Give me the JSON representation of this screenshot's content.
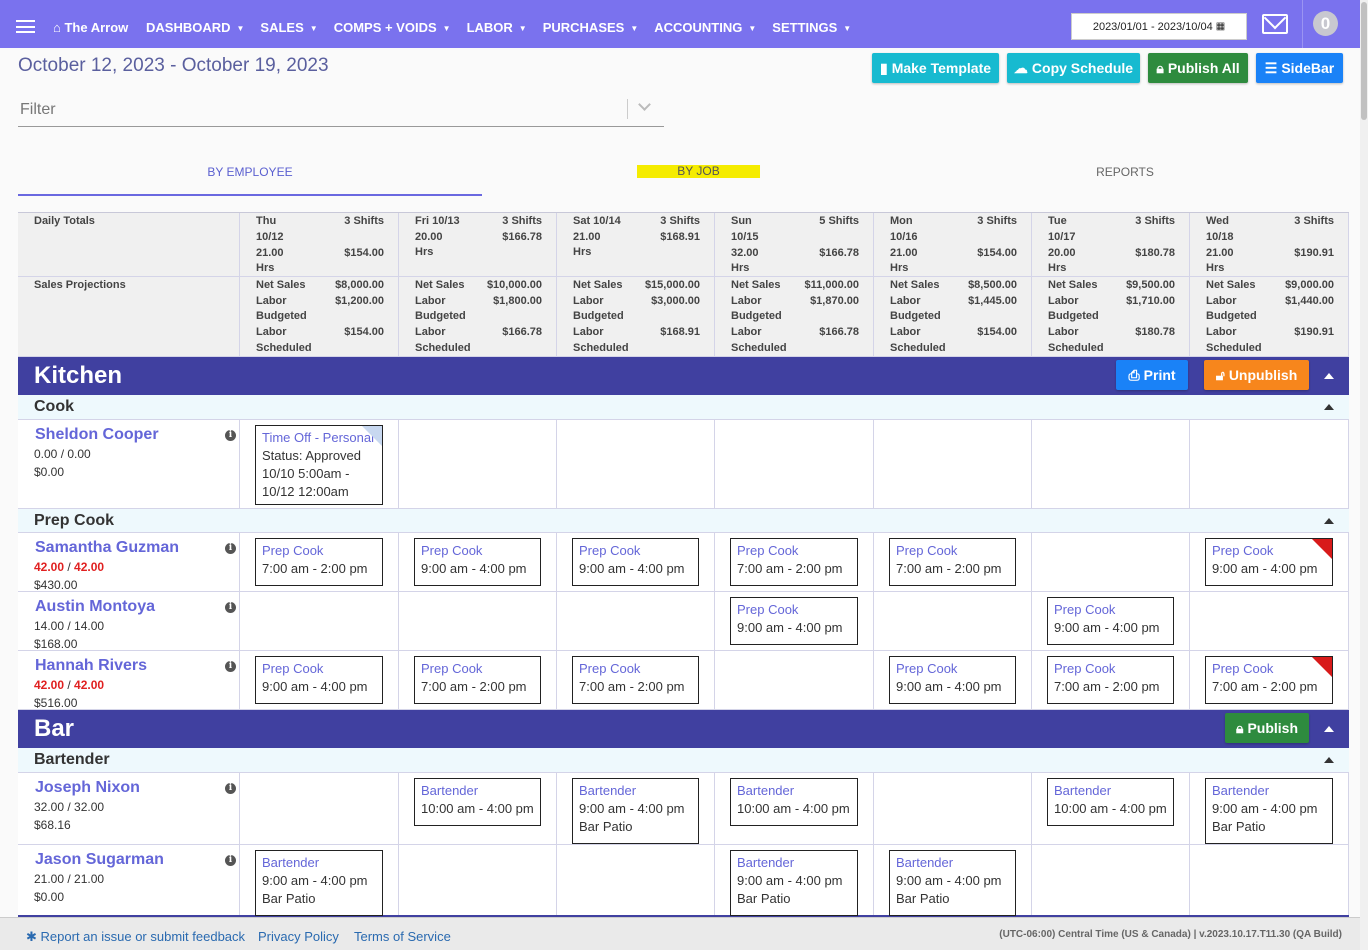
{
  "nav": {
    "brand": "The Arrow",
    "menu": [
      {
        "label": "DASHBOARD"
      },
      {
        "label": "SALES"
      },
      {
        "label": "COMPS + VOIDS"
      },
      {
        "label": "LABOR"
      },
      {
        "label": "PURCHASES"
      },
      {
        "label": "ACCOUNTING"
      },
      {
        "label": "SETTINGS"
      }
    ],
    "date_range": "2023/01/01 - 2023/10/04",
    "avatar": "0"
  },
  "header": {
    "week": "October 12, 2023 - October 19, 2023",
    "buttons": {
      "make_template": "Make Template",
      "copy_schedule": "Copy Schedule",
      "publish_all": "Publish All",
      "sidebar": "SideBar"
    },
    "filter_placeholder": "Filter"
  },
  "tabs": {
    "by_employee": "BY EMPLOYEE",
    "by_job": "BY JOB",
    "reports": "REPORTS"
  },
  "totals": {
    "label": "Daily Totals",
    "days": [
      {
        "day": "Thu",
        "date": "10/12",
        "shifts": "3 Shifts",
        "hrs": "21.00",
        "hrs_unit": "Hrs",
        "cost": "$154.00"
      },
      {
        "day": "Fri 10/13",
        "date": "",
        "shifts": "3 Shifts",
        "hrs": "20.00",
        "hrs_unit": "Hrs",
        "cost": "$166.78"
      },
      {
        "day": "Sat 10/14",
        "date": "",
        "shifts": "3 Shifts",
        "hrs": "21.00",
        "hrs_unit": "Hrs",
        "cost": "$168.91"
      },
      {
        "day": "Sun",
        "date": "10/15",
        "shifts": "5 Shifts",
        "hrs": "32.00",
        "hrs_unit": "Hrs",
        "cost": "$166.78"
      },
      {
        "day": "Mon",
        "date": "10/16",
        "shifts": "3 Shifts",
        "hrs": "21.00",
        "hrs_unit": "Hrs",
        "cost": "$154.00"
      },
      {
        "day": "Tue",
        "date": "10/17",
        "shifts": "3 Shifts",
        "hrs": "20.00",
        "hrs_unit": "Hrs",
        "cost": "$180.78"
      },
      {
        "day": "Wed",
        "date": "10/18",
        "shifts": "3 Shifts",
        "hrs": "21.00",
        "hrs_unit": "Hrs",
        "cost": "$190.91"
      }
    ]
  },
  "projections": {
    "label": "Sales Projections",
    "net_sales_label": "Net Sales",
    "labor_label": "Labor",
    "budgeted_label": "Budgeted",
    "scheduled_label": "Scheduled",
    "days": [
      {
        "net_sales": "$8,000.00",
        "budgeted": "$1,200.00",
        "scheduled": "$154.00"
      },
      {
        "net_sales": "$10,000.00",
        "budgeted": "$1,800.00",
        "scheduled": "$166.78"
      },
      {
        "net_sales": "$15,000.00",
        "budgeted": "$3,000.00",
        "scheduled": "$168.91"
      },
      {
        "net_sales": "$11,000.00",
        "budgeted": "$1,870.00",
        "scheduled": "$166.78"
      },
      {
        "net_sales": "$8,500.00",
        "budgeted": "$1,445.00",
        "scheduled": "$154.00"
      },
      {
        "net_sales": "$9,500.00",
        "budgeted": "$1,710.00",
        "scheduled": "$180.78"
      },
      {
        "net_sales": "$9,000.00",
        "budgeted": "$1,440.00",
        "scheduled": "$190.91"
      }
    ]
  },
  "kitchen": {
    "name": "Kitchen",
    "print": "Print",
    "unpublish": "Unpublish",
    "roles": {
      "cook": "Cook",
      "prep_cook": "Prep Cook"
    },
    "employees": [
      {
        "name": "Sheldon Cooper",
        "hrs_a": "0.00",
        "hrs_b": "0.00",
        "pay": "$0.00"
      },
      {
        "name": "Samantha Guzman",
        "hrs_a": "42.00",
        "hrs_b": "42.00",
        "pay": "$430.00"
      },
      {
        "name": "Austin Montoya",
        "hrs_a": "14.00",
        "hrs_b": "14.00",
        "pay": "$168.00"
      },
      {
        "name": "Hannah Rivers",
        "hrs_a": "42.00",
        "hrs_b": "42.00",
        "pay": "$516.00"
      }
    ],
    "timeoff": {
      "title": "Time Off - Personal",
      "status": "Status: Approved",
      "from": "10/10 5:00am -",
      "to": "10/12 12:00am"
    }
  },
  "bar": {
    "name": "Bar",
    "publish": "Publish",
    "roles": {
      "bartender": "Bartender"
    },
    "employees": [
      {
        "name": "Joseph Nixon",
        "hrs_a": "32.00",
        "hrs_b": "32.00",
        "pay": "$68.16"
      },
      {
        "name": "Jason Sugarman",
        "hrs_a": "21.00",
        "hrs_b": "21.00",
        "pay": "$0.00"
      }
    ]
  },
  "shift_labels": {
    "prep_cook": "Prep Cook",
    "bartender": "Bartender",
    "t_7_2": "7:00 am - 2:00 pm",
    "t_9_4": "9:00 am - 4:00 pm",
    "t_10_4": "10:00 am - 4:00 pm",
    "bar_patio": "Bar Patio"
  },
  "footer": {
    "report": "Report an issue or submit feedback",
    "privacy": "Privacy Policy",
    "terms": "Terms of Service",
    "version": "(UTC-06:00) Central Time (US & Canada) | v.2023.10.17.T11.30 (QA Build)"
  },
  "colors": {
    "nav": "#7a72ee",
    "group_header": "#4040a0",
    "accent_text": "#6466d8",
    "over_hours": "#e02020"
  }
}
